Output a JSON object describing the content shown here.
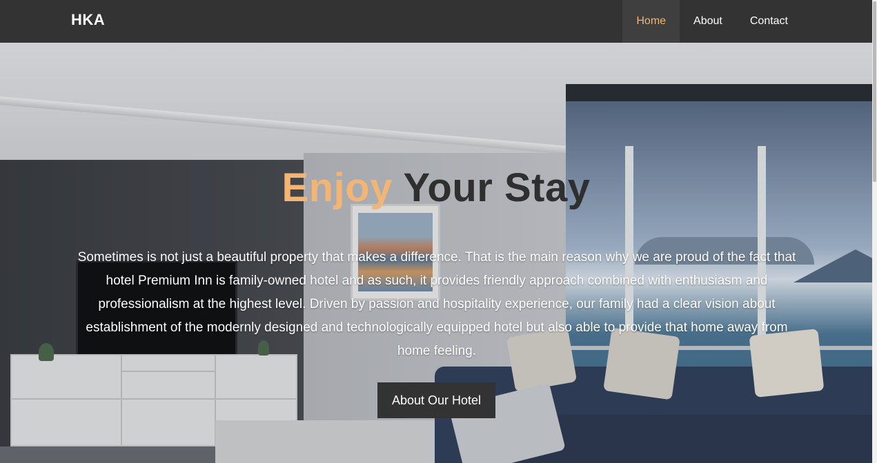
{
  "navbar": {
    "brand": "HKA",
    "links": [
      {
        "label": "Home",
        "active": true
      },
      {
        "label": "About",
        "active": false
      },
      {
        "label": "Contact",
        "active": false
      }
    ]
  },
  "hero": {
    "title_accent": "Enjoy",
    "title_rest": "Your Stay",
    "description": "Sometimes is not just a beautiful property that makes a difference. That is the main reason why we are proud of the fact that hotel Premium Inn is family-owned hotel and as such, it provides friendly approach combined with enthusiasm and professionalism at the highest level. Driven by passion and hospitality experience, our family had a clear vision about establishment of the modernly designed and technologically equipped hotel but also able to provide that home away from home feeling.",
    "button_label": "About Our Hotel",
    "background_image": "living-room-with-sea-view"
  },
  "colors": {
    "navbar_bg": "#333333",
    "accent": "#f3b573",
    "button_bg": "#333333",
    "title_dark": "#2f2f2f"
  }
}
